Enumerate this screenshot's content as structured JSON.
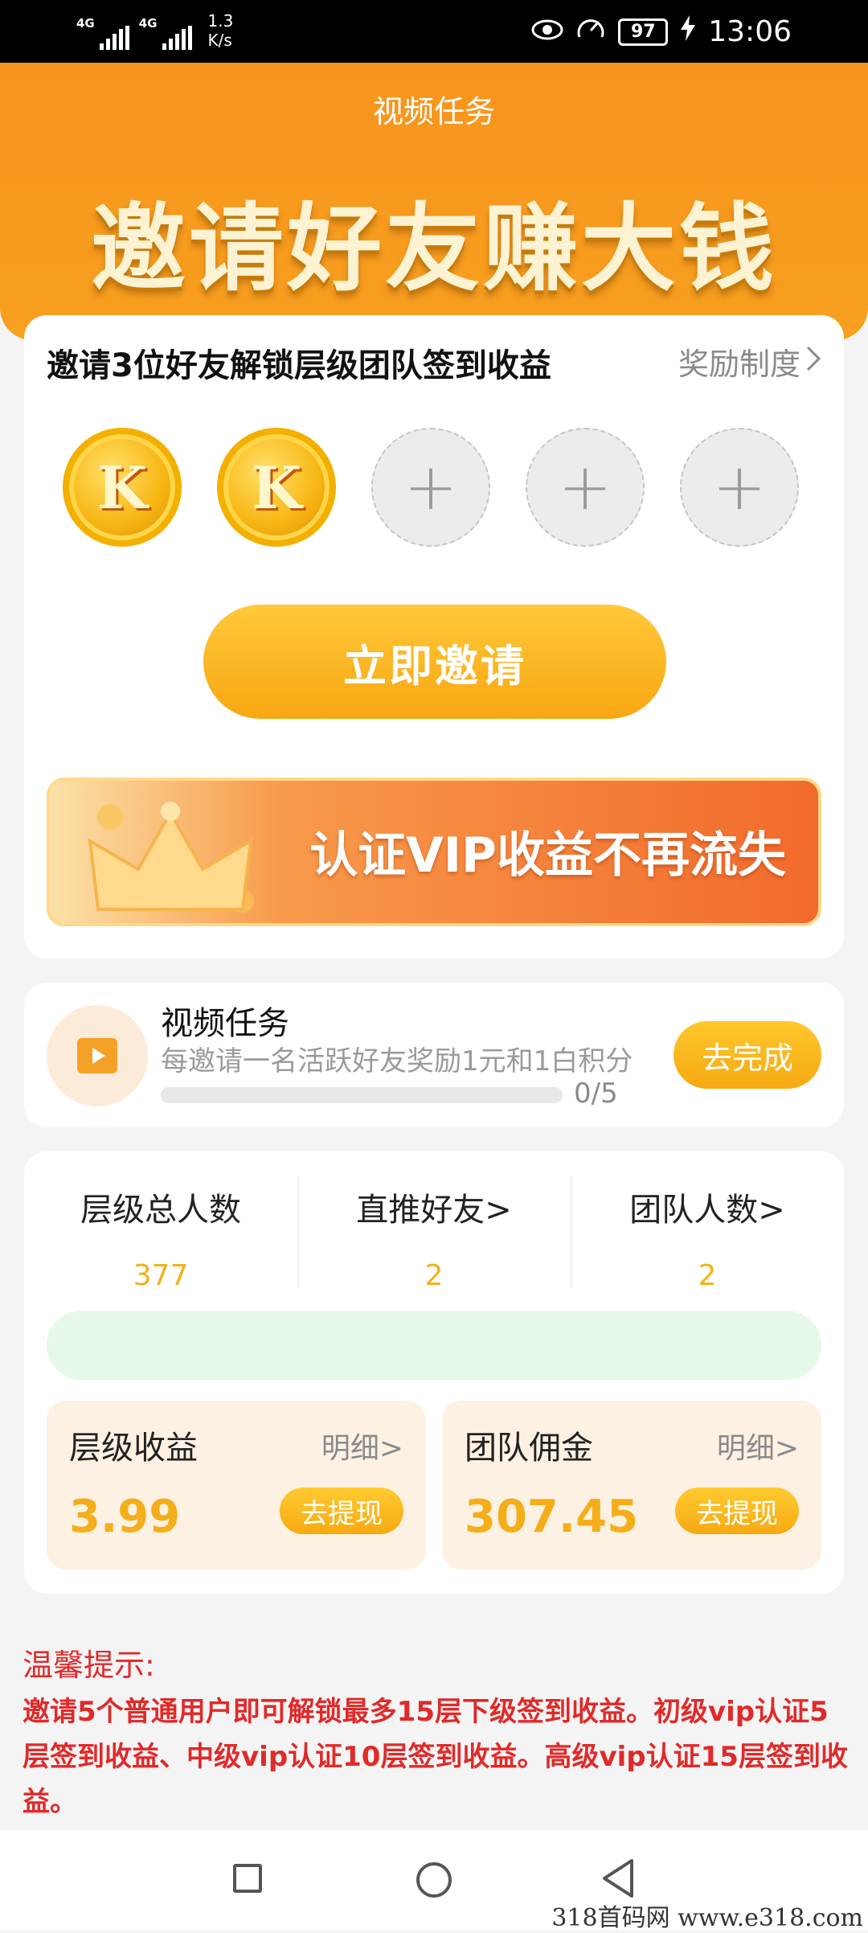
{
  "status_bar": {
    "network1": "4G",
    "network2": "4G",
    "speed_value": "1.3",
    "speed_unit": "K/s",
    "battery": "97",
    "time": "13:06",
    "icons": [
      "eye-icon",
      "speed-gauge-icon",
      "battery-icon",
      "charging-icon"
    ]
  },
  "header": {
    "title": "视频任务",
    "banner": "邀请好友赚大钱"
  },
  "invite_card": {
    "title": "邀请3位好友解锁层级团队签到收益",
    "reward_link": "奖励制度",
    "slots": [
      {
        "type": "filled",
        "label": "K"
      },
      {
        "type": "filled",
        "label": "K"
      },
      {
        "type": "empty",
        "label": "+"
      },
      {
        "type": "empty",
        "label": "+"
      },
      {
        "type": "empty",
        "label": "+"
      }
    ],
    "invite_button": "立即邀请",
    "vip_banner": "认证VIP收益不再流失"
  },
  "task_card": {
    "title": "视频任务",
    "description": "每邀请一名活跃好友奖励1元和1白积分",
    "progress_text": "0/5",
    "progress_fraction": 0,
    "button": "去完成"
  },
  "stats": {
    "items": [
      {
        "label": "层级总人数",
        "value": "377"
      },
      {
        "label": "直推好友>",
        "value": "2"
      },
      {
        "label": "团队人数>",
        "value": "2"
      }
    ]
  },
  "earnings": {
    "level": {
      "title": "层级收益",
      "detail": "明细>",
      "amount": "3.99",
      "button": "去提现"
    },
    "team": {
      "title": "团队佣金",
      "detail": "明细>",
      "amount": "307.45",
      "button": "去提现"
    }
  },
  "tips": {
    "heading": "温馨提示:",
    "body": "邀请5个普通用户即可解锁最多15层下级签到收益。初级vip认证5层签到收益、中级vip认证10层签到收益。高级vip认证15层签到收益。"
  },
  "watermark": "318首码网  www.e318.com",
  "colors": {
    "header_orange": "#f7941d",
    "accent_yellow": "#f8a612",
    "value_yellow": "#f0b21d",
    "tip_red": "#e02a2a",
    "green_bar": "#e6f9e8"
  }
}
